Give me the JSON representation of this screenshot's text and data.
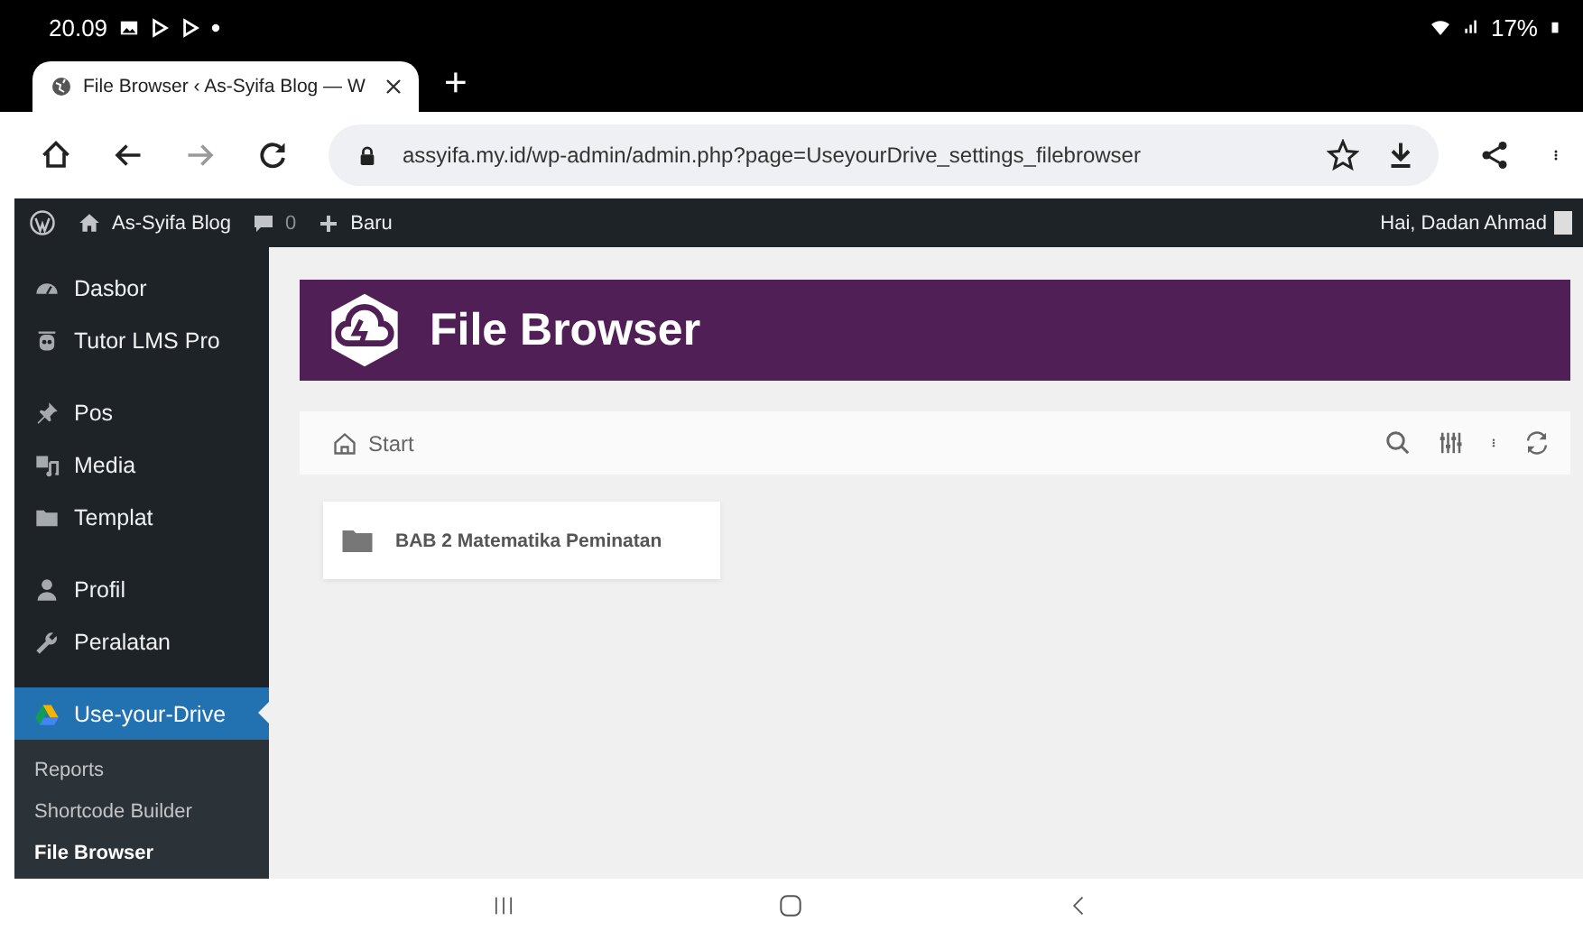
{
  "status_bar": {
    "time": "20.09",
    "battery": "17%"
  },
  "browser_tabs": [
    {
      "title": "File Browser ‹ As-Syifa Blog — W",
      "selected": true
    }
  ],
  "new_tab": "+",
  "address_bar": {
    "url": "assyifa.my.id/wp-admin/admin.php?page=UseyourDrive_settings_filebrowser"
  },
  "admin_bar": {
    "site": "As-Syifa Blog",
    "comments": "0",
    "new": "Baru",
    "greeting": "Hai, Dadan Ahmad"
  },
  "sidebar": {
    "items": [
      {
        "label": "Dasbor",
        "selected": false
      },
      {
        "label": "Tutor LMS Pro",
        "selected": false
      },
      {
        "label": "Pos",
        "selected": false
      },
      {
        "label": "Media",
        "selected": false
      },
      {
        "label": "Templat",
        "selected": false
      },
      {
        "label": "Profil",
        "selected": false
      },
      {
        "label": "Peralatan",
        "selected": false
      },
      {
        "label": "Use-your-Drive",
        "selected": true
      }
    ],
    "submenu": [
      {
        "label": "Reports",
        "selected": false
      },
      {
        "label": "Shortcode Builder",
        "selected": false
      },
      {
        "label": "File Browser",
        "selected": true
      }
    ]
  },
  "file_browser": {
    "title": "File Browser",
    "breadcrumb": "Start",
    "folders": [
      {
        "name": "BAB 2 Matematika Peminatan"
      }
    ]
  }
}
